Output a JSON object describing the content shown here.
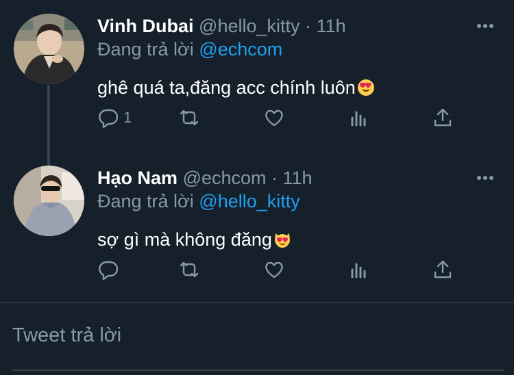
{
  "tweets": [
    {
      "name": "Vinh Dubai",
      "handle": "@hello_kitty",
      "dot": "·",
      "time": "11h",
      "reply_prefix": "Đang trả lời",
      "reply_to": "@echcom",
      "text": "ghê quá ta,đăng acc chính luôn",
      "emoji": "heart-eyes-emoji",
      "reply_count": "1"
    },
    {
      "name": "Hạo Nam",
      "handle": "@echcom",
      "dot": "·",
      "time": "11h",
      "reply_prefix": "Đang trả lời",
      "reply_to": "@hello_kitty",
      "text": "sợ gì mà không đăng",
      "emoji": "heart-eyes-cat-emoji",
      "reply_count": ""
    }
  ],
  "composer": {
    "placeholder": "Tweet trả lời"
  },
  "colors": {
    "background": "#15202b",
    "muted": "#8899a6",
    "accent": "#1da1f2",
    "divider": "#38444d"
  }
}
